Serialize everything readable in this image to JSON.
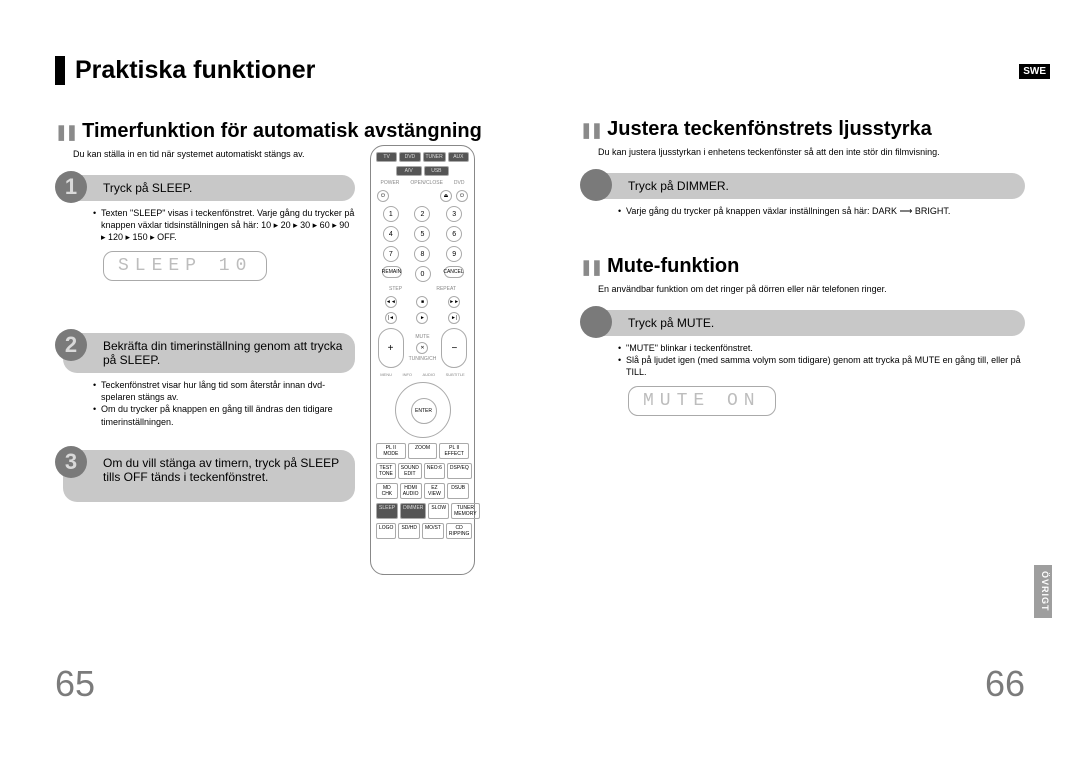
{
  "language_badge": "SWE",
  "side_tab": "ÖVRIGT",
  "left_page": {
    "number": "65",
    "title": "Praktiska funktioner",
    "timer": {
      "heading": "Timerfunktion för automatisk avstängning",
      "desc": "Du kan ställa in en tid när systemet automatiskt stängs av.",
      "step1_num": "1",
      "step1": "Tryck på SLEEP.",
      "bullet1": "Texten \"SLEEP\" visas i teckenfönstret. Varje gång du trycker på knappen växlar tidsinställningen så här: 10 ▸ 20 ▸ 30 ▸ 60 ▸ 90 ▸ 120 ▸ 150 ▸ OFF.",
      "lcd": "SLEEP 10",
      "step2_num": "2",
      "step2": "Bekräfta din timerinställning genom att trycka på SLEEP.",
      "bullet2a": "Teckenfönstret visar hur lång tid som återstår innan dvd-spelaren stängs av.",
      "bullet2b": "Om du trycker på knappen en gång till ändras den tidigare timerinställningen.",
      "step3_num": "3",
      "step3": "Om du vill stänga av timern, tryck på SLEEP tills OFF tänds i teckenfönstret."
    }
  },
  "right_page": {
    "number": "66",
    "dimmer": {
      "heading": "Justera teckenfönstrets ljusstyrka",
      "desc": "Du kan justera ljusstyrkan i enhetens teckenfönster så att den inte stör din filmvisning.",
      "step": "Tryck på DIMMER.",
      "bullet": "Varje gång du trycker på knappen växlar inställningen så här: DARK ⟶ BRIGHT."
    },
    "mute": {
      "heading": "Mute-funktion",
      "desc": "En användbar funktion om det ringer på dörren eller när telefonen ringer.",
      "step": "Tryck på MUTE.",
      "bullet1": "\"MUTE\" blinkar i teckenfönstret.",
      "bullet2": "Slå på ljudet igen (med samma volym som tidigare) genom att trycka på MUTE en gång till, eller på TILL.",
      "lcd": "MUTE ON"
    }
  },
  "remote": {
    "top_row": [
      "TV",
      "DVD",
      "TUNER",
      "AUX"
    ],
    "row2": [
      "A/V",
      "USB"
    ],
    "side_left": "POWER",
    "side_right_a": "OPEN/CLOSE",
    "side_right_b": "DVD",
    "num_row1": [
      "1",
      "2",
      "3"
    ],
    "num_row2": [
      "4",
      "5",
      "6"
    ],
    "num_row3": [
      "7",
      "8",
      "9"
    ],
    "num_row4_l": "REMAIN",
    "num_row4_c": "0",
    "num_row4_r": "CANCEL",
    "trans_lbl_step": "STEP",
    "trans_lbl_repeat": "REPEAT",
    "vol_plus": "+",
    "vol_minus": "−",
    "mute_lbl": "MUTE",
    "tuning_lbl": "TUNING/CH",
    "menu_row": [
      "MENU",
      "INFO",
      "AUDIO",
      "",
      "SUBTITLE"
    ],
    "enter": "ENTER",
    "bottom_row1": [
      "PL II MODE",
      "ZOOM",
      "PL II EFFECT"
    ],
    "bottom_row2": [
      "TEST TONE",
      "SOUND EDIT",
      "NEO:6",
      "DSP/EQ"
    ],
    "bottom_row3": [
      "MD CHK",
      "HDMI AUDIO",
      "EZ VIEW",
      "DSUB"
    ],
    "bottom_row4": [
      "SLEEP",
      "DIMMER",
      "SLOW",
      "TUNER MEMORY"
    ],
    "bottom_row5": [
      "LOGO",
      "SD/HD",
      "MO/ST",
      "CD RIPPING"
    ]
  }
}
